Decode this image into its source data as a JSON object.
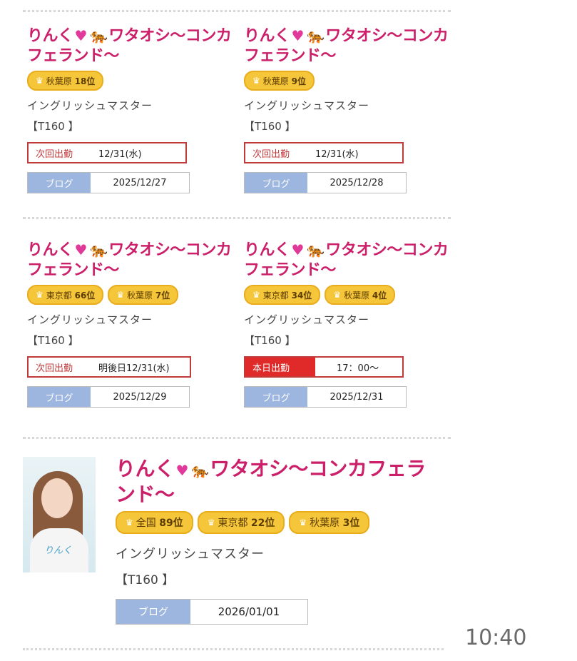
{
  "cards": [
    {
      "title": "りんく",
      "title_suffix": "ワタオシ〜コンカフェランド〜",
      "badges": [
        {
          "area": "秋葉原",
          "rank": "18位"
        }
      ],
      "shop": "イングリッシュマスター",
      "size": "【T160 】",
      "schedule_label": "次回出勤",
      "schedule_value": "12/31(水)",
      "blog_label": "ブログ",
      "blog_date": "2025/12/27"
    },
    {
      "title": "りんく",
      "title_suffix": "ワタオシ〜コンカフェランド〜",
      "badges": [
        {
          "area": "秋葉原",
          "rank": "9位"
        }
      ],
      "shop": "イングリッシュマスター",
      "size": "【T160 】",
      "schedule_label": "次回出勤",
      "schedule_value": "12/31(水)",
      "blog_label": "ブログ",
      "blog_date": "2025/12/28"
    },
    {
      "title": "りんく",
      "title_suffix": "ワタオシ〜コンカフェランド〜",
      "badges": [
        {
          "area": "東京都",
          "rank": "66位"
        },
        {
          "area": "秋葉原",
          "rank": "7位"
        }
      ],
      "shop": "イングリッシュマスター",
      "size": "【T160 】",
      "schedule_label": "次回出勤",
      "schedule_value": "明後日12/31(水)",
      "blog_label": "ブログ",
      "blog_date": "2025/12/29"
    },
    {
      "title": "りんく",
      "title_suffix": "ワタオシ〜コンカフェランド〜",
      "badges": [
        {
          "area": "東京都",
          "rank": "34位"
        },
        {
          "area": "秋葉原",
          "rank": "4位"
        }
      ],
      "shop": "イングリッシュマスター",
      "size": "【T160 】",
      "schedule_label": "本日出勤",
      "schedule_value": "17：00〜",
      "blog_label": "ブログ",
      "blog_date": "2025/12/31"
    }
  ],
  "featured": {
    "title": "りんく",
    "title_suffix": "ワタオシ〜コンカフェランド〜",
    "badges": [
      {
        "area": "全国",
        "rank": "89位"
      },
      {
        "area": "東京都",
        "rank": "22位"
      },
      {
        "area": "秋葉原",
        "rank": "3位"
      }
    ],
    "shop": "イングリッシュマスター",
    "size": "【T160 】",
    "blog_label": "ブログ",
    "blog_date": "2026/01/01",
    "photo_caption": "りんく"
  },
  "status_bar": {
    "time": "10:40"
  },
  "icons": {
    "heart": "heart-icon",
    "crown": "crown-icon",
    "tiger": "tiger-icon"
  },
  "colors": {
    "title": "#cc1f6a",
    "badge": "#f6c63a",
    "schedule_border": "#c23b3b",
    "today": "#e02929",
    "blog_label": "#9cb6df"
  }
}
